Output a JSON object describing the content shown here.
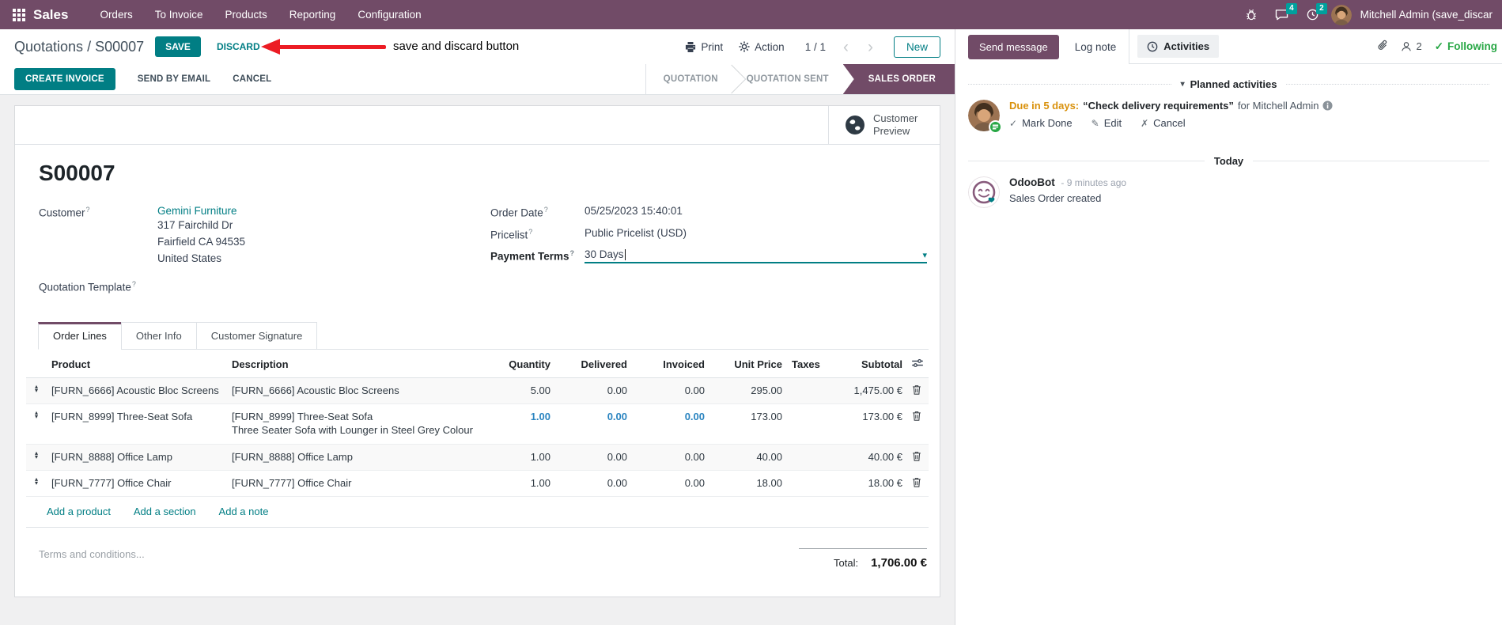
{
  "nav": {
    "app_name": "Sales",
    "menus": [
      "Orders",
      "To Invoice",
      "Products",
      "Reporting",
      "Configuration"
    ],
    "messages_badge": "4",
    "activities_badge": "2",
    "user_name": "Mitchell Admin (save_discar"
  },
  "control": {
    "breadcrumb_parent": "Quotations",
    "breadcrumb_sep": " / ",
    "breadcrumb_current": "S00007",
    "save_label": "SAVE",
    "discard_label": "DISCARD",
    "annotation": "save and discard button",
    "print_label": "Print",
    "action_label": "Action",
    "pager": "1 / 1",
    "new_label": "New"
  },
  "statusbar": {
    "buttons": [
      "CREATE INVOICE",
      "SEND BY EMAIL",
      "CANCEL"
    ],
    "stages": [
      {
        "label": "QUOTATION",
        "active": false
      },
      {
        "label": "QUOTATION SENT",
        "active": false
      },
      {
        "label": "SALES ORDER",
        "active": true
      }
    ]
  },
  "form": {
    "preview_button": "Customer Preview",
    "title": "S00007",
    "help_marker": "?",
    "customer_label": "Customer",
    "customer_name": "Gemini Furniture",
    "address_line1": "317 Fairchild Dr",
    "address_line2": "Fairfield CA 94535",
    "address_line3": "United States",
    "quotation_template_label": "Quotation Template",
    "order_date_label": "Order Date",
    "order_date_value": "05/25/2023 15:40:01",
    "pricelist_label": "Pricelist",
    "pricelist_value": "Public Pricelist (USD)",
    "payment_terms_label": "Payment Terms",
    "payment_terms_value": "30 Days"
  },
  "tabs": [
    "Order Lines",
    "Other Info",
    "Customer Signature"
  ],
  "order_lines": {
    "columns": [
      "Product",
      "Description",
      "Quantity",
      "Delivered",
      "Invoiced",
      "Unit Price",
      "Taxes",
      "Subtotal"
    ],
    "rows": [
      {
        "product": "[FURN_6666] Acoustic Bloc Screens",
        "description": "[FURN_6666] Acoustic Bloc Screens",
        "description2": "",
        "quantity": "5.00",
        "delivered": "0.00",
        "invoiced": "0.00",
        "unit_price": "295.00",
        "taxes": "",
        "subtotal": "1,475.00 €"
      },
      {
        "product": "[FURN_8999] Three-Seat Sofa",
        "description": "[FURN_8999] Three-Seat Sofa",
        "description2": "Three Seater Sofa with Lounger in Steel Grey Colour",
        "quantity": "1.00",
        "delivered": "0.00",
        "invoiced": "0.00",
        "unit_price": "173.00",
        "taxes": "",
        "subtotal": "173.00 €"
      },
      {
        "product": "[FURN_8888] Office Lamp",
        "description": "[FURN_8888] Office Lamp",
        "description2": "",
        "quantity": "1.00",
        "delivered": "0.00",
        "invoiced": "0.00",
        "unit_price": "40.00",
        "taxes": "",
        "subtotal": "40.00 €"
      },
      {
        "product": "[FURN_7777] Office Chair",
        "description": "[FURN_7777] Office Chair",
        "description2": "",
        "quantity": "1.00",
        "delivered": "0.00",
        "invoiced": "0.00",
        "unit_price": "18.00",
        "taxes": "",
        "subtotal": "18.00 €"
      }
    ],
    "footer_links": [
      "Add a product",
      "Add a section",
      "Add a note"
    ],
    "terms_placeholder": "Terms and conditions...",
    "total_label": "Total:",
    "total_value": "1,706.00 €"
  },
  "chatter": {
    "send_message": "Send message",
    "log_note": "Log note",
    "activities": "Activities",
    "followers_count": "2",
    "following": "Following",
    "planned_header": "Planned activities",
    "activity": {
      "due": "Due in 5 days:",
      "title": "“Check delivery requirements”",
      "for_text": "for Mitchell Admin",
      "actions": [
        "Mark Done",
        "Edit",
        "Cancel"
      ]
    },
    "today": "Today",
    "message": {
      "author": "OdooBot",
      "time": "- 9 minutes ago",
      "body": "Sales Order created"
    }
  },
  "glyphs": {
    "chev_left": "‹",
    "chev_right": "›",
    "caret_down": "▾",
    "check": "✓",
    "pencil": "✎",
    "cross": "✗",
    "drag_up": "▴",
    "drag_down": "▾"
  },
  "colors": {
    "navbar_bg": "#714B67",
    "accent_teal": "#017E84",
    "badge_teal": "#00A09D",
    "stage_active_bg": "#714B67",
    "following_green": "#28a745",
    "due_orange": "#d9910c",
    "edited_blue": "#2a84c0",
    "annotation_red": "#ec1c24"
  }
}
